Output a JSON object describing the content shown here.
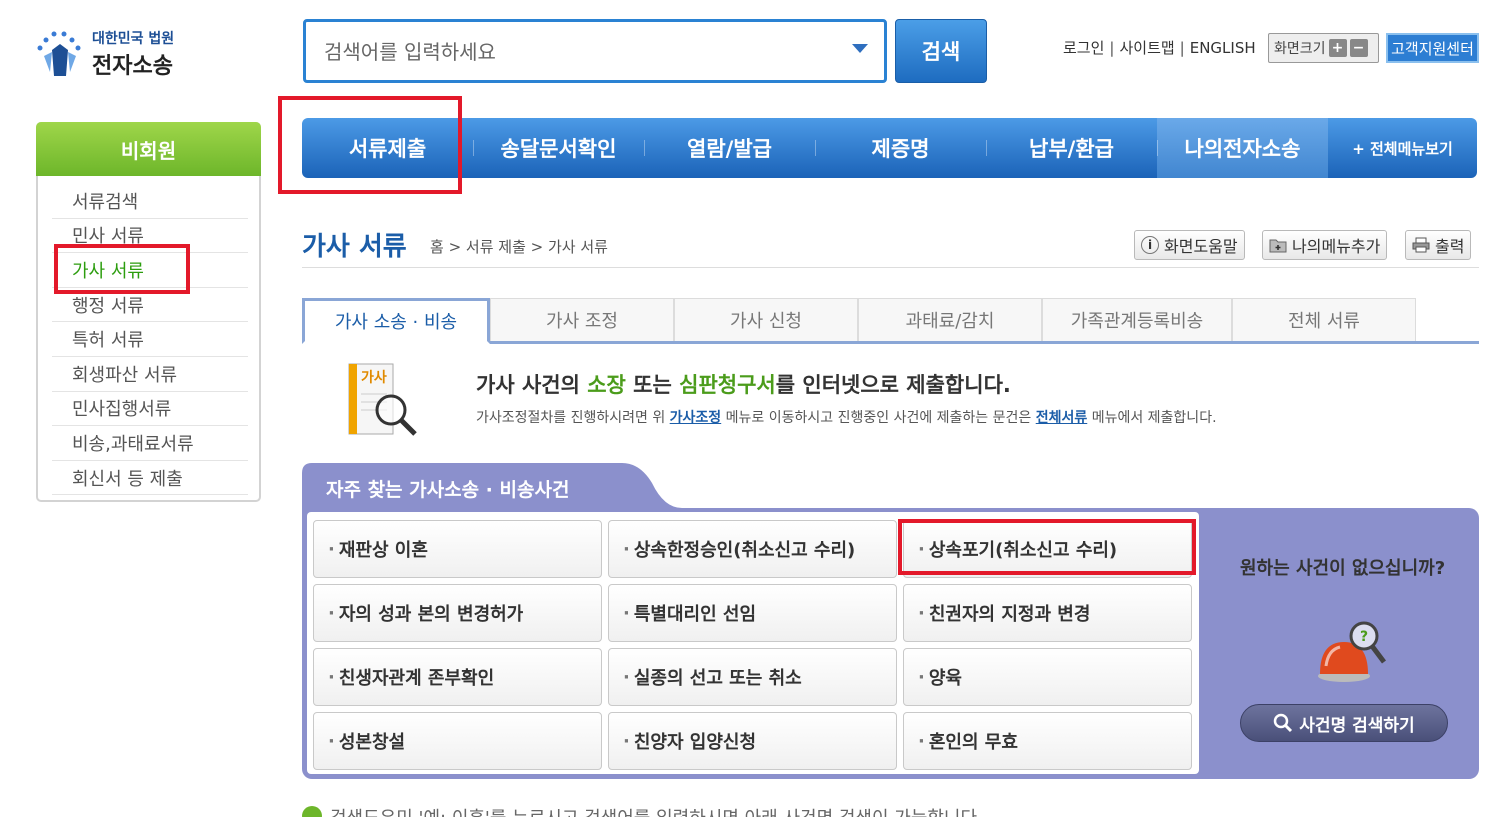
{
  "logo": {
    "sub": "대한민국 법원",
    "main": "전자소송"
  },
  "search": {
    "placeholder": "검색어를 입력하세요",
    "button": "검색"
  },
  "utility": {
    "login": "로그인",
    "sitemap": "사이트맵",
    "english": "ENGLISH",
    "font_size": "화면크기",
    "plus": "+",
    "minus": "−",
    "support": "고객지원센터"
  },
  "sidebar": {
    "heading": "비회원",
    "items": [
      "서류검색",
      "민사 서류",
      "가사 서류",
      "행정 서류",
      "특허 서류",
      "회생파산 서류",
      "민사집행서류",
      "비송,과태료서류",
      "회신서 등 제출"
    ],
    "active_index": 2
  },
  "nav": {
    "items": [
      "서류제출",
      "송달문서확인",
      "열람/발급",
      "제증명",
      "납부/환급",
      "나의전자소송"
    ],
    "all_menu": "+ 전체메뉴보기"
  },
  "page": {
    "title": "가사 서류",
    "breadcrumb": "홈 > 서류 제출 > 가사 서류",
    "help": "화면도움말",
    "add_menu": "나의메뉴추가",
    "print": "출력"
  },
  "tabs": [
    "가사 소송 · 비송",
    "가사 조정",
    "가사 신청",
    "과태료/감치",
    "가족관계등록비송",
    "전체 서류"
  ],
  "intro": {
    "icon_label": "가사",
    "title_pre": "가사 사건의 ",
    "title_g1": "소장",
    "title_mid": " 또는 ",
    "title_g2": "심판청구서",
    "title_post": "를 인터넷으로 제출합니다.",
    "desc_pre": "가사조정절차를 진행하시려면 위 ",
    "desc_link1": "가사조정",
    "desc_mid": " 메뉴로 이동하시고 진행중인 사건에 제출하는 문건은 ",
    "desc_link2": "전체서류",
    "desc_post": " 메뉴에서 제출합니다."
  },
  "frequent": {
    "title": "자주 찾는 가사소송 · 비송사건",
    "cases": [
      "재판상 이혼",
      "상속한정승인(취소신고 수리)",
      "상속포기(취소신고 수리)",
      "자의 성과 본의 변경허가",
      "특별대리인 선임",
      "친권자의 지정과 변경",
      "친생자관계 존부확인",
      "실종의 선고 또는 취소",
      "양육",
      "성본창설",
      "친양자 입양신청",
      "혼인의 무효"
    ],
    "question": "원하는 사건이 없으십니까?",
    "search_button": "사건명 검색하기"
  },
  "footer_note": "검색도우미 '예: 이혼'를 누르시고 검색어를 입력하시면 아래 사건명 검색이 가능합니다."
}
